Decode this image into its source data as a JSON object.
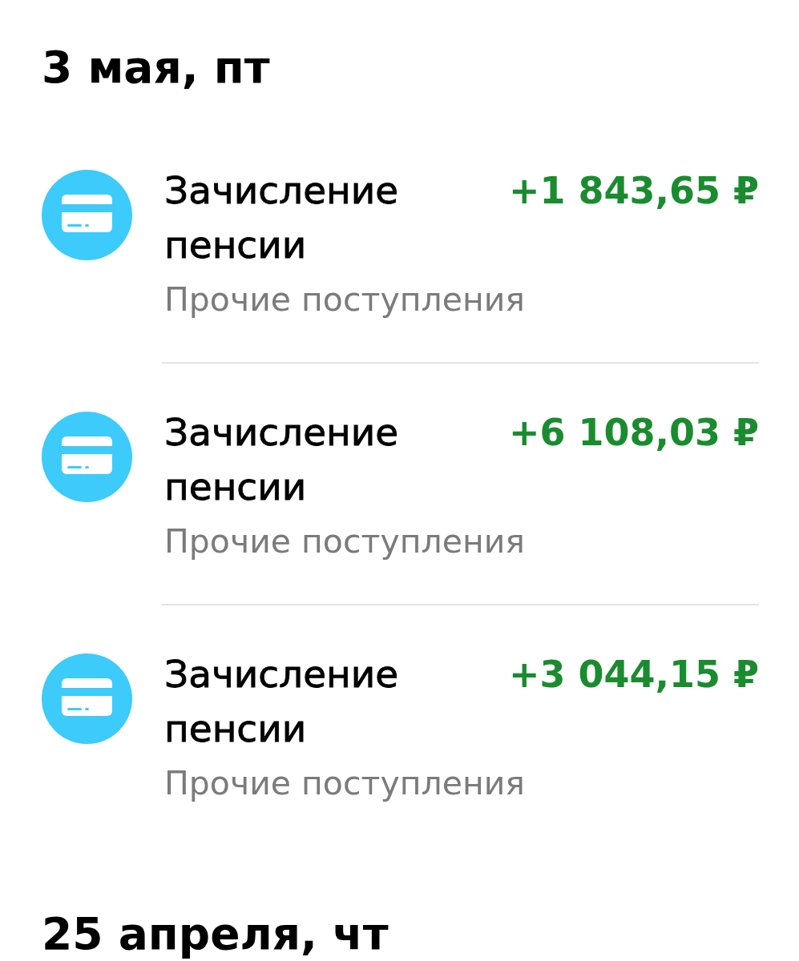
{
  "sections": [
    {
      "date": "3 мая, пт",
      "transactions": [
        {
          "title": "Зачисление пенсии",
          "category": "Прочие поступления",
          "amount": "+1 843,65 ₽"
        },
        {
          "title": "Зачисление пенсии",
          "category": "Прочие поступления",
          "amount": "+6 108,03 ₽"
        },
        {
          "title": "Зачисление пенсии",
          "category": "Прочие поступления",
          "amount": "+3 044,15 ₽"
        }
      ]
    },
    {
      "date": "25 апреля, чт"
    }
  ]
}
